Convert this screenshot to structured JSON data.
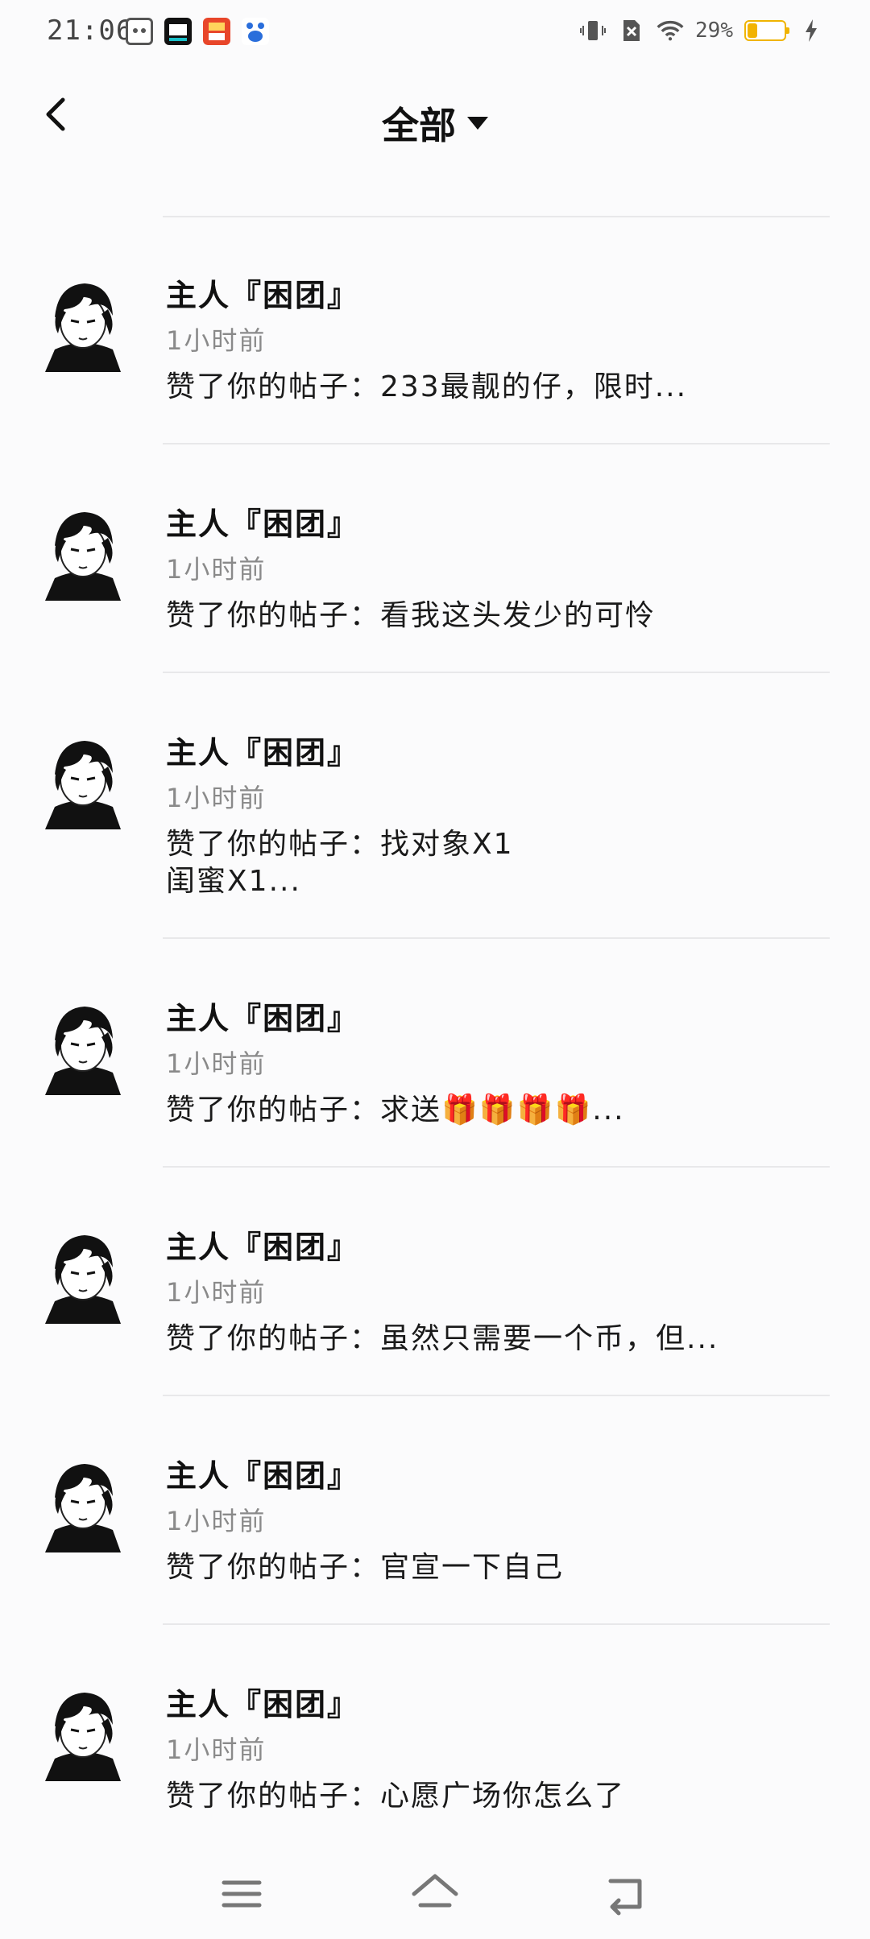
{
  "status_bar": {
    "time": "21:06",
    "battery_percent": "29%",
    "battery_level": 0.29,
    "app_icons": [
      "robot-app-icon",
      "shopping-app-icon",
      "orange-app-icon",
      "baidu-app-icon"
    ]
  },
  "header": {
    "title": "全部"
  },
  "items": [
    {
      "name": "主人『困团』",
      "time": "1小时前",
      "content": "赞了你的帖子：233最靓的仔，限时..."
    },
    {
      "name": "主人『困团』",
      "time": "1小时前",
      "content": "赞了你的帖子：看我这头发少的可怜"
    },
    {
      "name": "主人『困团』",
      "time": "1小时前",
      "content": "赞了你的帖子：找对象X1\n闺蜜X1..."
    },
    {
      "name": "主人『困团』",
      "time": "1小时前",
      "content": "赞了你的帖子：求送🎁🎁🎁🎁..."
    },
    {
      "name": "主人『困团』",
      "time": "1小时前",
      "content": "赞了你的帖子：虽然只需要一个币，但..."
    },
    {
      "name": "主人『困团』",
      "time": "1小时前",
      "content": "赞了你的帖子：官宣一下自己"
    },
    {
      "name": "主人『困团』",
      "time": "1小时前",
      "content": "赞了你的帖子：心愿广场你怎么了"
    }
  ],
  "colors": {
    "background": "#fbfbfc",
    "divider": "#e8e8ea",
    "battery": "#f2b300",
    "secondary_text": "#8a8a8a"
  }
}
